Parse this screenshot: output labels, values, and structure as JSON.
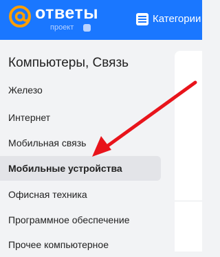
{
  "header": {
    "brand": "ответы",
    "project_label": "проект",
    "vk_badge": "VK",
    "categories_label": "Категории",
    "brand_color": "#1a77ff"
  },
  "sidebar": {
    "title": "Компьютеры, Связь",
    "items": [
      {
        "label": "Железо"
      },
      {
        "label": "Интернет"
      },
      {
        "label": "Мобильная связь"
      },
      {
        "label": "Мобильные устройства",
        "active": true
      },
      {
        "label": "Офисная техника"
      },
      {
        "label": "Программное обеспечение"
      },
      {
        "label": "Прочее компьютерное"
      }
    ]
  },
  "annotation": {
    "icon": "red-arrow-icon",
    "color": "#e8141b"
  }
}
